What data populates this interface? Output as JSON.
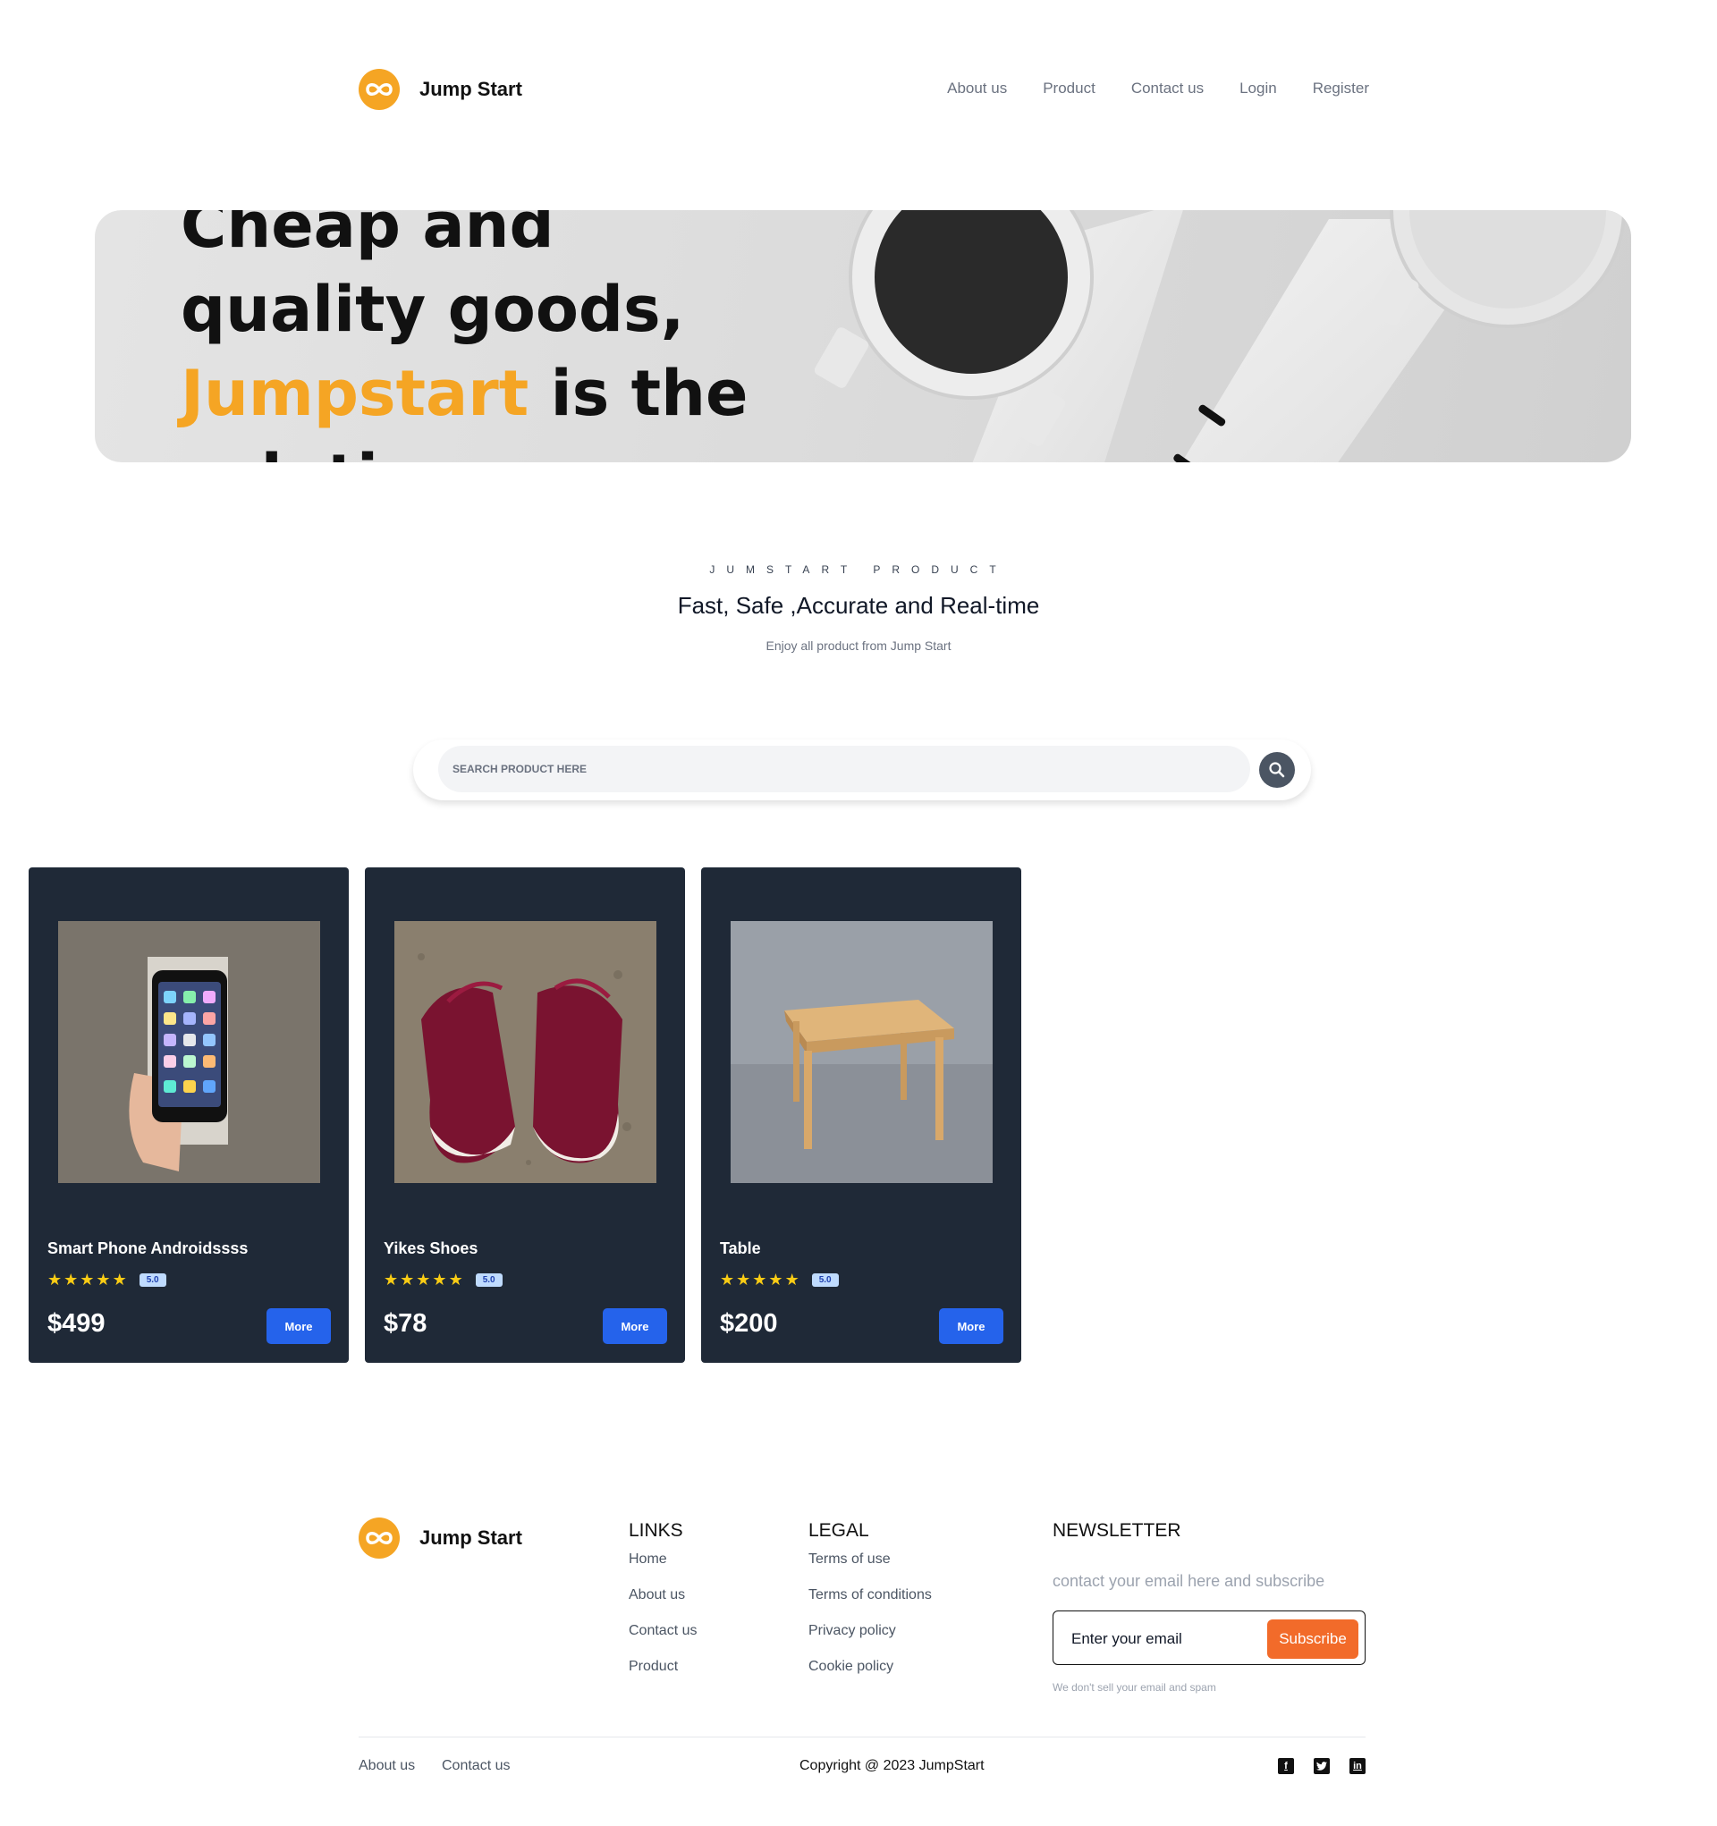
{
  "header": {
    "brand": "Jump Start",
    "nav": [
      "About us",
      "Product",
      "Contact us",
      "Login",
      "Register"
    ]
  },
  "hero": {
    "line1": "Cheap and",
    "line2": "quality goods,",
    "highlight": "Jumpstart",
    "line3_rest": " is the",
    "line4": "solution"
  },
  "section": {
    "kicker": "JUMSTART PRODUCT",
    "title": "Fast, Safe ,Accurate and Real-time",
    "caption": "Enjoy all product from Jump Start"
  },
  "search": {
    "placeholder": "SEARCH PRODUCT HERE"
  },
  "products": [
    {
      "name": "Smart Phone Androidssss",
      "rating": "5.0",
      "stars": 5,
      "price": "$499",
      "button": "More",
      "image": "smartphone-in-hand"
    },
    {
      "name": "Yikes Shoes",
      "rating": "5.0",
      "stars": 5,
      "price": "$78",
      "button": "More",
      "image": "red-sneakers"
    },
    {
      "name": "Table",
      "rating": "5.0",
      "stars": 5,
      "price": "$200",
      "button": "More",
      "image": "wooden-table"
    }
  ],
  "footer": {
    "brand": "Jump Start",
    "links_title": "LINKS",
    "links": [
      "Home",
      "About us",
      "Contact us",
      "Product"
    ],
    "legal_title": "LEGAL",
    "legal": [
      "Terms of use",
      "Terms of conditions",
      "Privacy policy",
      "Cookie policy"
    ],
    "newsletter_title": "NEWSLETTER",
    "newsletter_caption": "contact your email here and subscribe",
    "email_placeholder": "Enter your email",
    "subscribe": "Subscribe",
    "note": "We don't sell your email and spam",
    "bottom_links": [
      "About us",
      "Contact us"
    ],
    "copyright": "Copyright @ 2023 JumpStart",
    "social_icons": [
      "facebook-icon",
      "twitter-icon",
      "linkedin-icon"
    ]
  },
  "colors": {
    "accent": "#F5A524",
    "primary_button": "#2563EB",
    "subscribe_button": "#F26B2A",
    "card_bg": "#1F2937",
    "star": "#FACC15"
  }
}
